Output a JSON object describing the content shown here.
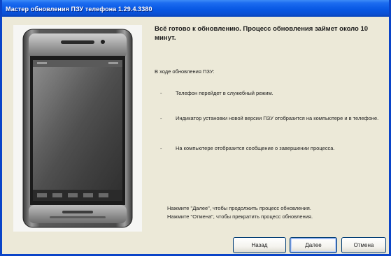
{
  "window": {
    "title": "Мастер обновления ПЗУ телефона 1.29.4.3380"
  },
  "heading": "Всё готово к обновлению. Процесс обновления займет около 10 минут.",
  "intro": "В ходе обновления ПЗУ:",
  "bullets": [
    {
      "dash": "-",
      "text": "Телефон перейдет в служебный режим."
    },
    {
      "dash": "-",
      "text": "Индикатор установки новой версии ПЗУ отобразится на компьютере и в телефоне."
    },
    {
      "dash": "-",
      "text": "На компьютере отобразится сообщение о завершении процесса."
    }
  ],
  "footer": {
    "line1": "Нажмите \"Далее\", чтобы продолжить процесс обновления.",
    "line2": "Нажмите \"Отмена\", чтобы прекратить процесс обновления."
  },
  "buttons": {
    "back": "Назад",
    "next": "Далее",
    "cancel": "Отмена"
  },
  "colors": {
    "titlebar": "#0a4fd3",
    "dialog": "#ece9d8"
  }
}
